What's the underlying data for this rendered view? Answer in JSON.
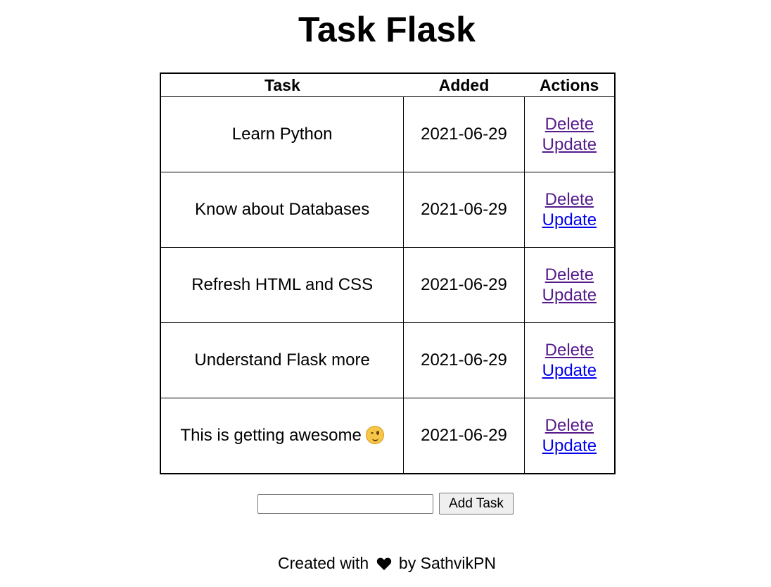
{
  "title": "Task Flask",
  "table": {
    "headers": {
      "task": "Task",
      "added": "Added",
      "actions": "Actions"
    },
    "rows": [
      {
        "task": "Learn Python",
        "added": "2021-06-29",
        "delete": "Delete",
        "update": "Update"
      },
      {
        "task": "Know about Databases",
        "added": "2021-06-29",
        "delete": "Delete",
        "update": "Update"
      },
      {
        "task": "Refresh HTML and CSS",
        "added": "2021-06-29",
        "delete": "Delete",
        "update": "Update"
      },
      {
        "task": "Understand Flask more",
        "added": "2021-06-29",
        "delete": "Delete",
        "update": "Update"
      },
      {
        "task": "This is getting awesome",
        "added": "2021-06-29",
        "delete": "Delete",
        "update": "Update",
        "emoji": "winking-face-icon"
      }
    ]
  },
  "form": {
    "input_value": "",
    "input_placeholder": "",
    "button_label": "Add Task"
  },
  "footer": {
    "prefix": "Created with",
    "icon": "heart-icon",
    "suffix": "by SathvikPN"
  },
  "colors": {
    "link_visited": "#551a8b",
    "link_unvisited": "#0000ee",
    "text": "#000000",
    "background": "#ffffff"
  }
}
